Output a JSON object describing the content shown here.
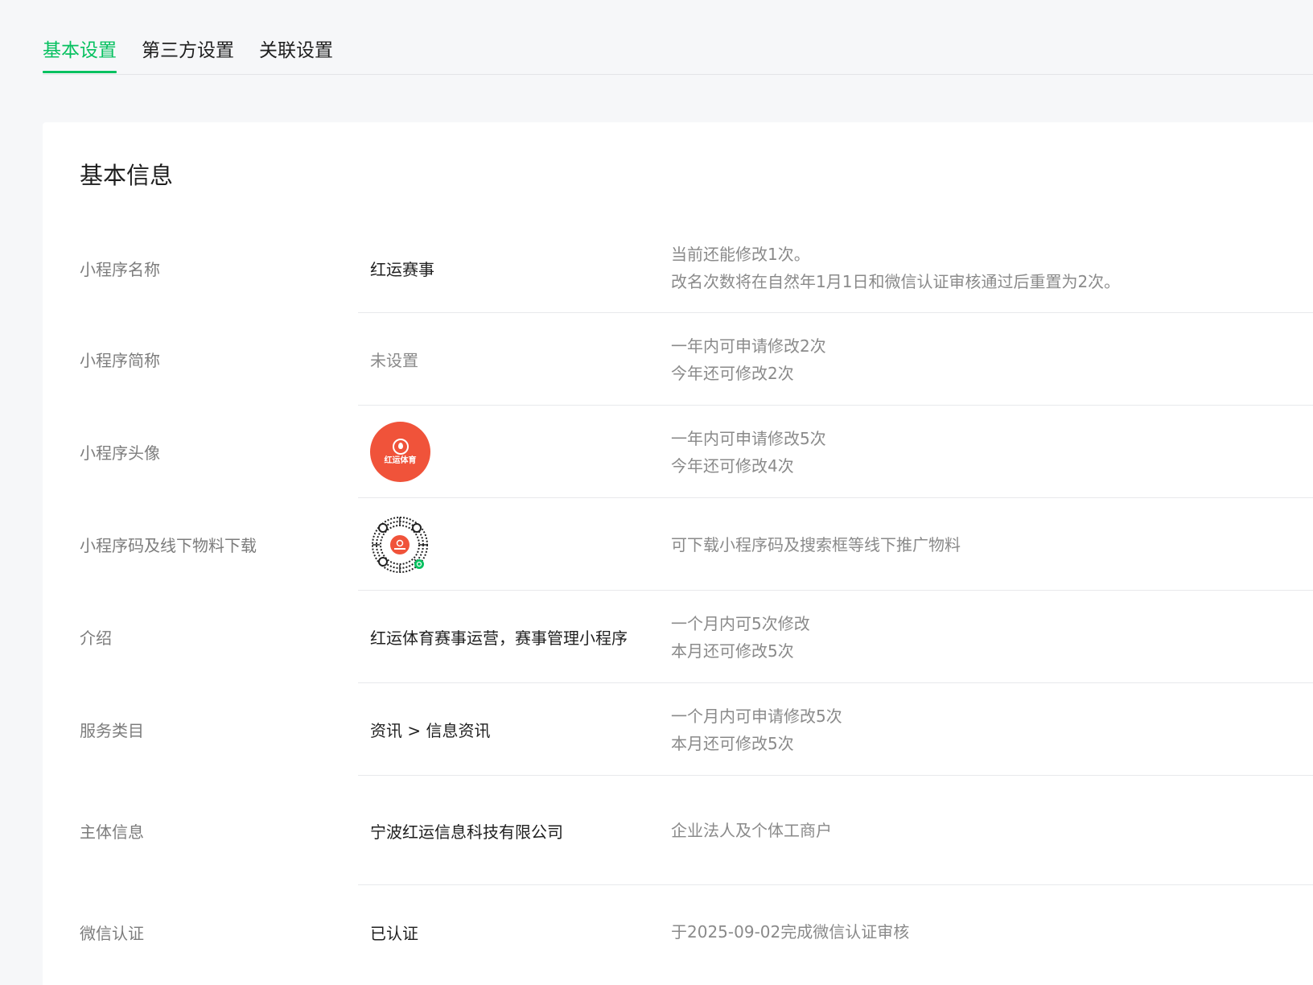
{
  "tabs": [
    {
      "label": "基本设置",
      "active": true
    },
    {
      "label": "第三方设置",
      "active": false
    },
    {
      "label": "关联设置",
      "active": false
    }
  ],
  "accent_color": "#07c160",
  "card": {
    "title": "基本信息",
    "rows": [
      {
        "label": "小程序名称",
        "value": "红运赛事",
        "desc": [
          "当前还能修改1次。",
          "改名次数将在自然年1月1日和微信认证审核通过后重置为2次。"
        ]
      },
      {
        "label": "小程序简称",
        "value": "未设置",
        "desc": [
          "一年内可申请修改2次",
          "今年还可修改2次"
        ]
      },
      {
        "label": "小程序头像",
        "avatar_text": "红运体育",
        "avatar_icon": "flame-logo-icon",
        "desc": [
          "一年内可申请修改5次",
          "今年还可修改4次"
        ]
      },
      {
        "label": "小程序码及线下物料下载",
        "qr_icon": "mini-program-code-icon",
        "desc": [
          "可下载小程序码及搜索框等线下推广物料"
        ]
      },
      {
        "label": "介绍",
        "value": "红运体育赛事运营，赛事管理小程序",
        "desc": [
          "一个月内可5次修改",
          "本月还可修改5次"
        ]
      },
      {
        "label": "服务类目",
        "value": "资讯 > 信息资讯",
        "desc": [
          "一个月内可申请修改5次",
          "本月还可修改5次"
        ]
      },
      {
        "label": "主体信息",
        "value": "宁波红运信息科技有限公司",
        "desc": [
          "企业法人及个体工商户"
        ]
      },
      {
        "label": "微信认证",
        "value": "已认证",
        "desc": [
          "于2025-09-02完成微信认证审核"
        ]
      }
    ]
  }
}
